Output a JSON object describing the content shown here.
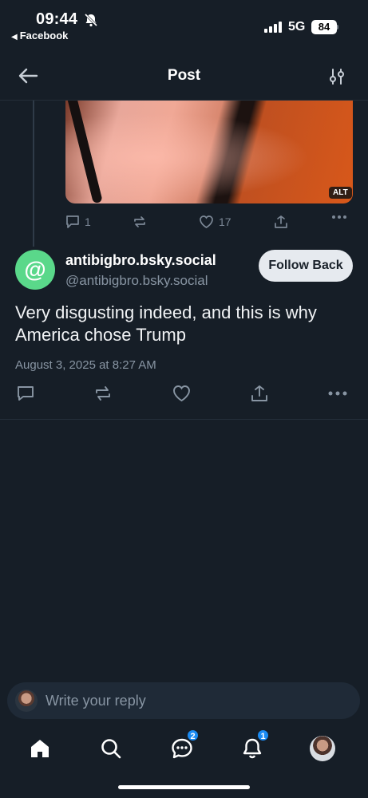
{
  "status_bar": {
    "time": "09:44",
    "back_app": "Facebook",
    "network": "5G",
    "battery": "84"
  },
  "header": {
    "title": "Post"
  },
  "previous_post": {
    "alt_badge": "ALT",
    "replies": "1",
    "likes": "17"
  },
  "post": {
    "display_name": "antibigbro.bsky.social",
    "handle": "@antibigbro.bsky.social",
    "avatar_symbol": "@",
    "follow_label": "Follow Back",
    "text": "Very disgusting indeed, and this is why America chose Trump",
    "timestamp": "August 3, 2025 at 8:27 AM"
  },
  "reply": {
    "placeholder": "Write your reply"
  },
  "tabbar": {
    "chat_badge": "2",
    "notifications_badge": "1",
    "items": [
      "home-icon",
      "search-icon",
      "chat-icon",
      "bell-icon",
      "profile-avatar"
    ]
  },
  "colors": {
    "background": "#161e27",
    "muted": "#8895a3",
    "accent": "#1b8bf2",
    "avatar": "#5ad88a"
  }
}
